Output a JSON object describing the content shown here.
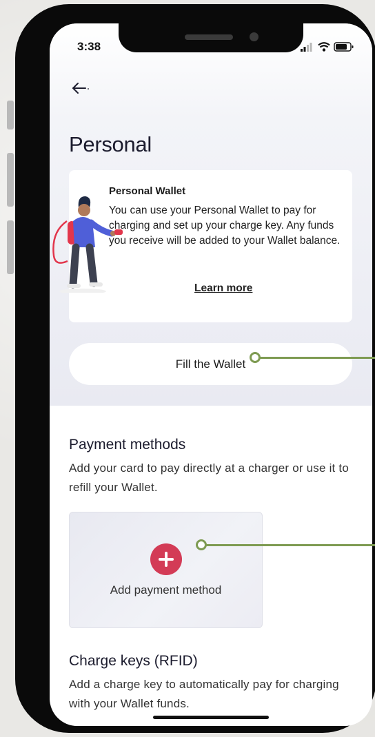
{
  "status_bar": {
    "time": "3:38",
    "icons": [
      "signal-icon",
      "wifi-icon",
      "battery-icon"
    ]
  },
  "header": {
    "back_icon": "back-arrow-icon",
    "title": "Personal"
  },
  "wallet_card": {
    "title": "Personal Wallet",
    "description": "You can use your Personal Wallet to pay for charging and set up your charge key. Any funds you receive will be added to your Wallet balance.",
    "learn_more": "Learn more"
  },
  "fill_button": {
    "label": "Fill the Wallet"
  },
  "payment_methods": {
    "title": "Payment methods",
    "description": "Add your card to pay directly at a charger or use it to refill your Wallet.",
    "add_label": "Add payment method",
    "add_icon": "plus-circle-icon"
  },
  "charge_keys": {
    "title": "Charge keys (RFID)",
    "description": "Add a charge key to automatically pay for charging with your Wallet funds."
  },
  "colors": {
    "accent_red": "#d33b56",
    "callout_green": "#7e9b52",
    "title_text": "#1c1c2e"
  }
}
